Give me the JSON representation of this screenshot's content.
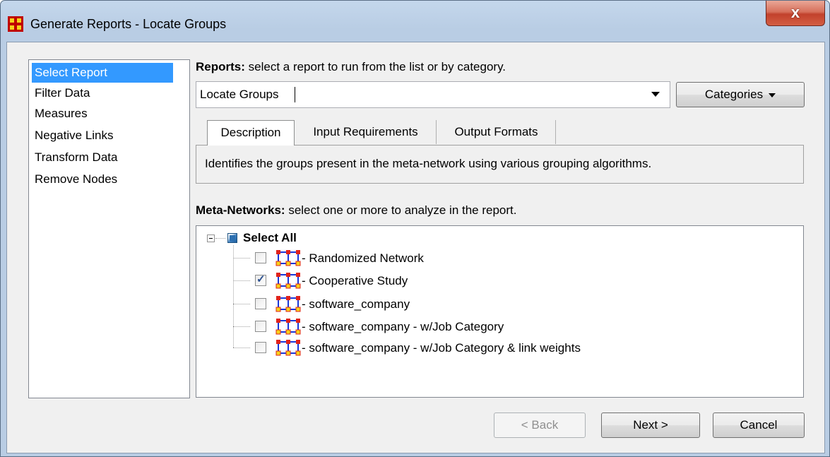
{
  "window": {
    "title": "Generate Reports - Locate Groups",
    "close_label": "x"
  },
  "nav": {
    "items": [
      {
        "label": "Select Report",
        "selected": true
      },
      {
        "label": "Filter Data",
        "selected": false
      },
      {
        "label": "Measures",
        "selected": false
      },
      {
        "label": "Negative Links",
        "selected": false
      },
      {
        "label": "Transform Data",
        "selected": false
      },
      {
        "label": "Remove Nodes",
        "selected": false
      }
    ]
  },
  "reports": {
    "label_bold": "Reports:",
    "label_rest": " select a report to run from the list or by category.",
    "selected_value": "Locate Groups",
    "categories_label": "Categories"
  },
  "tabs": [
    {
      "label": "Description",
      "active": true
    },
    {
      "label": "Input Requirements",
      "active": false
    },
    {
      "label": "Output Formats",
      "active": false
    }
  ],
  "description": "Identifies the groups present in the meta-network using various grouping algorithms.",
  "meta_networks": {
    "label_bold": "Meta-Networks:",
    "label_rest": " select one or more to analyze in the report.",
    "select_all_label": "Select All",
    "items": [
      {
        "label": "- Randomized Network",
        "checked": false
      },
      {
        "label": "- Cooperative Study",
        "checked": true
      },
      {
        "label": "- software_company",
        "checked": false
      },
      {
        "label": "- software_company - w/Job Category",
        "checked": false
      },
      {
        "label": "- software_company - w/Job Category & link weights",
        "checked": false
      }
    ]
  },
  "footer": {
    "back_label": "< Back",
    "next_label": "Next >",
    "cancel_label": "Cancel"
  },
  "colors": {
    "selection": "#3399ff",
    "icon_node_red": "#e0231b",
    "icon_node_yellow": "#f5d21a",
    "icon_link_blue": "#1a36d9"
  },
  "icons": {
    "app": "network-grid-icon",
    "network": "meta-network-icon",
    "close": "close-icon"
  }
}
